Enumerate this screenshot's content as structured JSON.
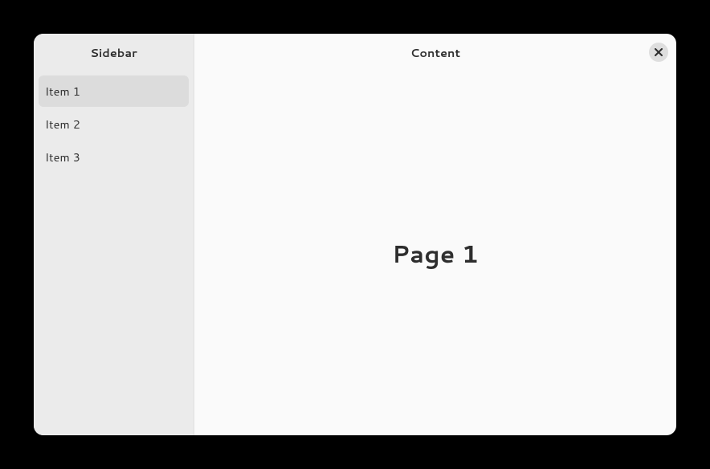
{
  "sidebar": {
    "title": "Sidebar",
    "items": [
      {
        "label": "Item 1",
        "selected": true
      },
      {
        "label": "Item 2",
        "selected": false
      },
      {
        "label": "Item 3",
        "selected": false
      }
    ]
  },
  "content": {
    "title": "Content",
    "page_heading": "Page 1"
  }
}
